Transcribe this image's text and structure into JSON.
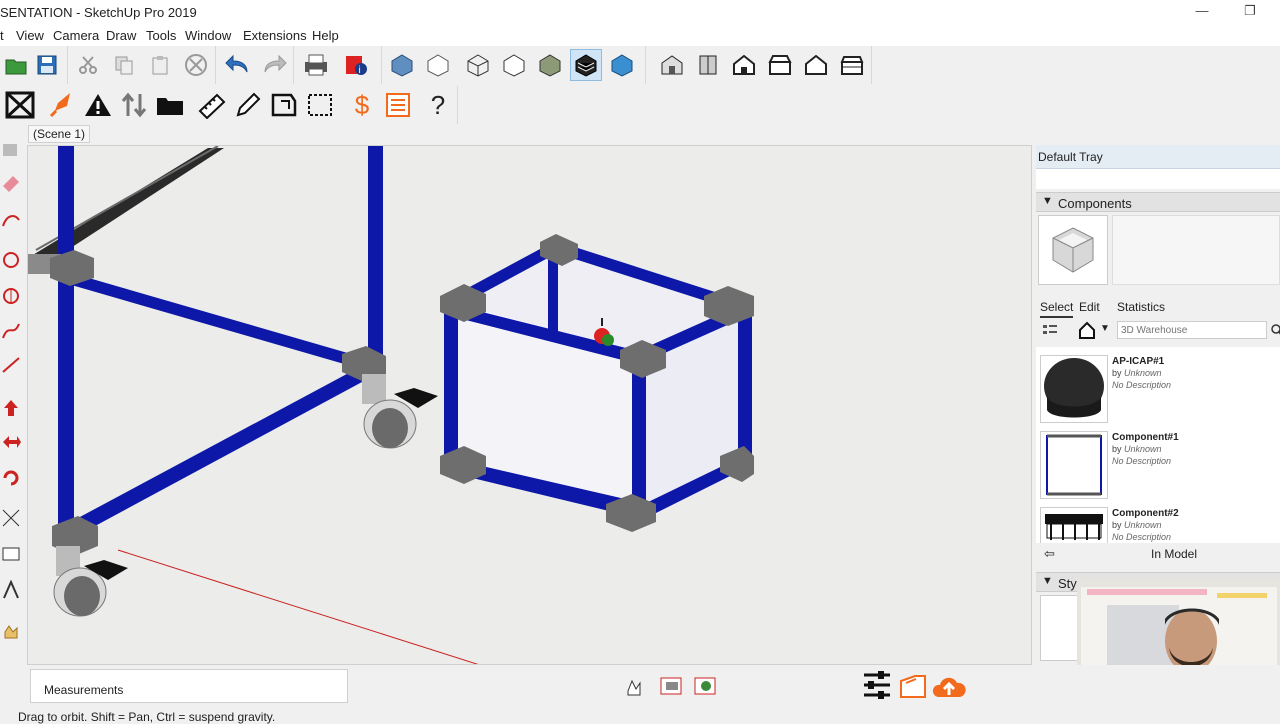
{
  "window": {
    "title": "SENTATION - SketchUp Pro 2019",
    "minimize_glyph": "—",
    "restore_glyph": "❐"
  },
  "menu": [
    "t",
    "View",
    "Camera",
    "Draw",
    "Tools",
    "Window",
    "Extensions",
    "Help"
  ],
  "toolbar": {
    "row1_groups": [
      "file-tools",
      "edit-tools",
      "undo-redo",
      "print",
      "display-styles",
      "views"
    ],
    "row2_icons": [
      "section-plane-icon",
      "rocket-icon",
      "warning-icon",
      "sort-icon",
      "folder-icon",
      "tape-icon",
      "pencil-icon",
      "shape-icon",
      "bounding-box-icon",
      "dollar-icon",
      "list-icon",
      "help-icon"
    ],
    "dollar_glyph": "$",
    "help_glyph": "?"
  },
  "scene": {
    "tab_label": "(Scene 1)"
  },
  "tray": {
    "title": "Default Tray",
    "components_header": "Components",
    "tabs": {
      "select": "Select",
      "edit": "Edit",
      "statistics": "Statistics"
    },
    "search_placeholder": "3D Warehouse",
    "items": [
      {
        "name": "AP-ICAP#1",
        "by_label": "by",
        "author": "Unknown",
        "description": "No Description"
      },
      {
        "name": "Component#1",
        "by_label": "by",
        "author": "Unknown",
        "description": "No Description"
      },
      {
        "name": "Component#2",
        "by_label": "by",
        "author": "Unknown",
        "description": "No Description"
      }
    ],
    "in_model_label": "In Model",
    "styles_header": "Styl"
  },
  "status": {
    "measurements_label": "Measurements",
    "hint": "Drag to orbit. Shift = Pan, Ctrl = suspend gravity."
  },
  "colors": {
    "pipe_blue": "#0d17a8",
    "joint_gray": "#6e6e6e",
    "panel_white": "#f4f4f8",
    "accent_orange": "#f26a1b"
  }
}
